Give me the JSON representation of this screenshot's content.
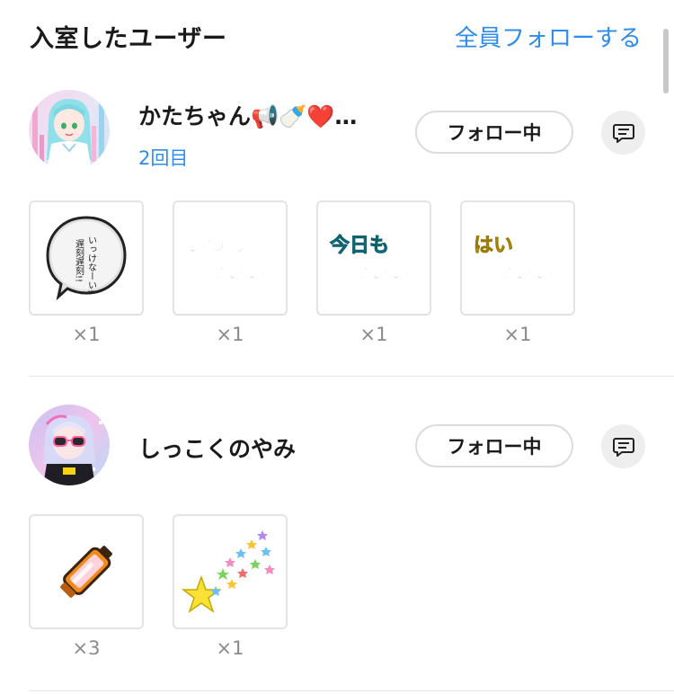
{
  "header": {
    "title": "入室したユーザー",
    "follow_all": "全員フォローする"
  },
  "users": [
    {
      "name": "かたちゃん📢🍼❤️…",
      "visit": "2回目",
      "follow_label": "フォロー中",
      "gifts": [
        {
          "icon": "speech-bubble-gift-icon",
          "text": "いっけなーい!\n遅刻遅刻!!",
          "count": "×1"
        },
        {
          "icon": "itsumo-kawaii-gift-icon",
          "line1": "いつも",
          "line2": "かわいい",
          "count": "×1"
        },
        {
          "icon": "kyoumo-kawaii-gift-icon",
          "line1": "今日も",
          "line2": "かわいい",
          "count": "×1"
        },
        {
          "icon": "hai-kawaii-gift-icon",
          "line1": "はい",
          "line2": "かわいい",
          "count": "×1"
        }
      ]
    },
    {
      "name": "しっこくのやみ",
      "follow_label": "フォロー中",
      "gifts": [
        {
          "icon": "battery-gift-icon",
          "count": "×3"
        },
        {
          "icon": "star-shower-gift-icon",
          "count": "×1"
        }
      ]
    }
  ],
  "colors": {
    "accent": "#2d8cec",
    "itsumo": "#e8164f",
    "kyoumo": "#22c4dc",
    "hai": "#f5d310",
    "kawaii": "#e8164f"
  }
}
